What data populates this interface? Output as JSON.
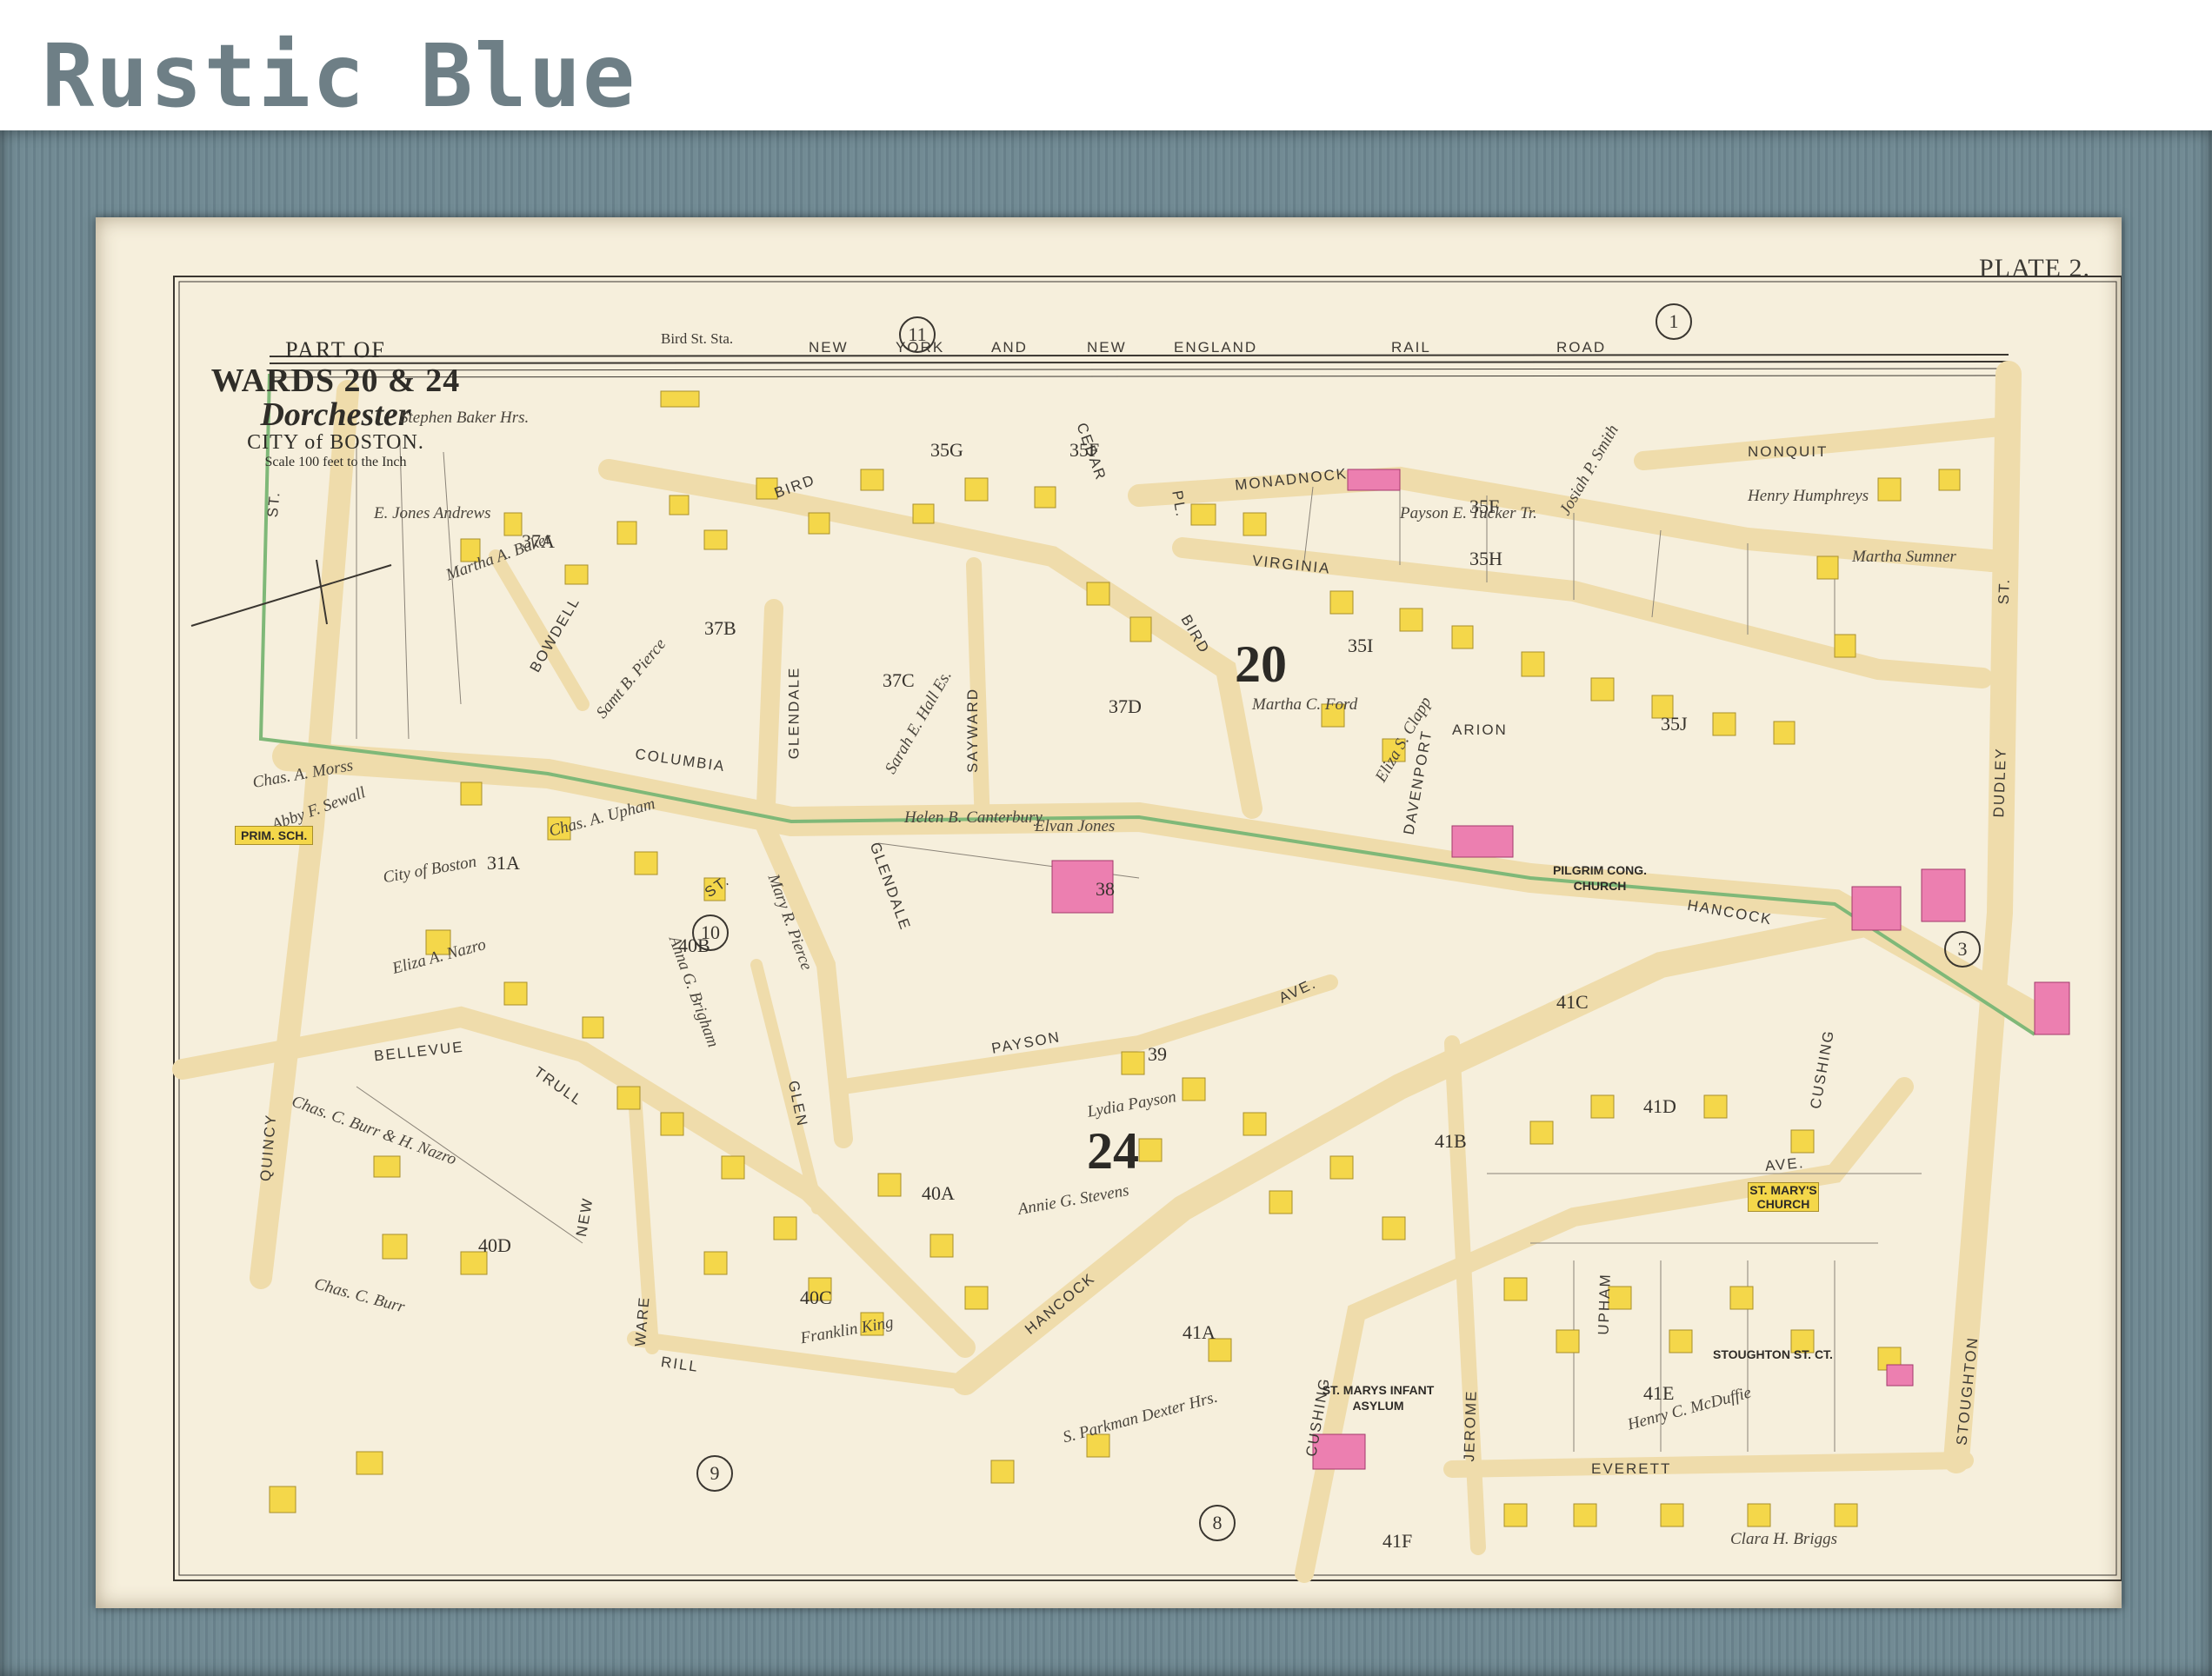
{
  "brand": {
    "title": "Rustic Blue",
    "color": "#6e7f86"
  },
  "frame": {
    "color": "#6d8791",
    "mat_color": "#f6efdc"
  },
  "map": {
    "plate": "PLATE 2.",
    "legend": {
      "part_of": "PART OF",
      "wards": "WARDS 20 & 24",
      "district": "Dorchester",
      "city": "CITY of BOSTON.",
      "scale": "Scale 100 feet to the Inch"
    },
    "station": "Bird St. Sta.",
    "railroad": [
      "NEW",
      "YORK",
      "AND",
      "NEW",
      "ENGLAND",
      "RAIL",
      "ROAD"
    ],
    "streets": {
      "nonquit": "NONQUIT",
      "monadnock": "MONADNOCK",
      "virginia": "VIRGINIA",
      "columbia": "COLUMBIA",
      "glendale": "GLENDALE",
      "sayward": "SAYWARD",
      "bird": "BIRD",
      "cedar": "CEDAR",
      "bowdell": "BOWDELL",
      "quincy": "QUINCY",
      "bellevue": "BELLEVUE",
      "trull": "TRULL",
      "new": "NEW",
      "ware": "WARE",
      "rill": "RILL",
      "glen": "GLEN",
      "payson": "PAYSON",
      "hancock": "HANCOCK",
      "dudley": "DUDLEY",
      "stoughton": "STOUGHTON",
      "cushing": "CUSHING",
      "jerome": "JEROME",
      "upham": "UPHAM",
      "everett": "EVERETT",
      "davenport": "DAVENPORT",
      "arion": "ARION",
      "st": "ST.",
      "ave": "AVE.",
      "pl": "PL."
    },
    "wards_big": {
      "w20": "20",
      "w24": "24"
    },
    "sheet_refs": {
      "s1": "1",
      "s3": "3",
      "s8": "8",
      "s9": "9",
      "s10": "10",
      "s11": "11"
    },
    "plots": [
      "37A",
      "37B",
      "37C",
      "37D",
      "35G",
      "35F",
      "35H",
      "35I",
      "35J",
      "35K",
      "38",
      "39",
      "40A",
      "40B",
      "40C",
      "40D",
      "41A",
      "41B",
      "41C",
      "41D",
      "41E",
      "41F",
      "31A"
    ],
    "owners": [
      "Stephen Baker Hrs.",
      "E. Jones Andrews",
      "Martha A. Baker",
      "Samt B. Pierce",
      "Sarah E. Hall Es.",
      "Henry Humphreys",
      "Martha Sumner",
      "Payson E. Tucker Tr.",
      "Martha C. Ford",
      "Eliza S. Clapp",
      "Chas. A. Upham",
      "City of Boston",
      "Eliza A. Nazro",
      "Chas. C. Burr & H. Nazro",
      "Chas. C. Burr",
      "Helen B. Canterbury",
      "Elvan Jones",
      "Mary R. Pierce",
      "Anna G. Brigham",
      "Lydia Payson",
      "Annie G. Stevens",
      "Franklin King",
      "S. Parkman Dexter Hrs.",
      "Henry C. McDuffie",
      "Clara H. Briggs",
      "Josiah P. Smith",
      "Chas. A. Morss",
      "Abby F. Sewall"
    ],
    "institutions": {
      "school": "PRIM. SCH.",
      "pilgrim": "PILGRIM CONG. CHURCH",
      "st_marys_church": "ST. MARY'S CHURCH",
      "asylum": "ST. MARYS INFANT ASYLUM",
      "stoughton_st_ct": "STOUGHTON ST. CT."
    },
    "colors": {
      "road": "#efdcab",
      "building": "#f4d74a",
      "brick": "#ec7fb0",
      "green_line": "#7fb878",
      "ink": "#3a3630"
    }
  }
}
